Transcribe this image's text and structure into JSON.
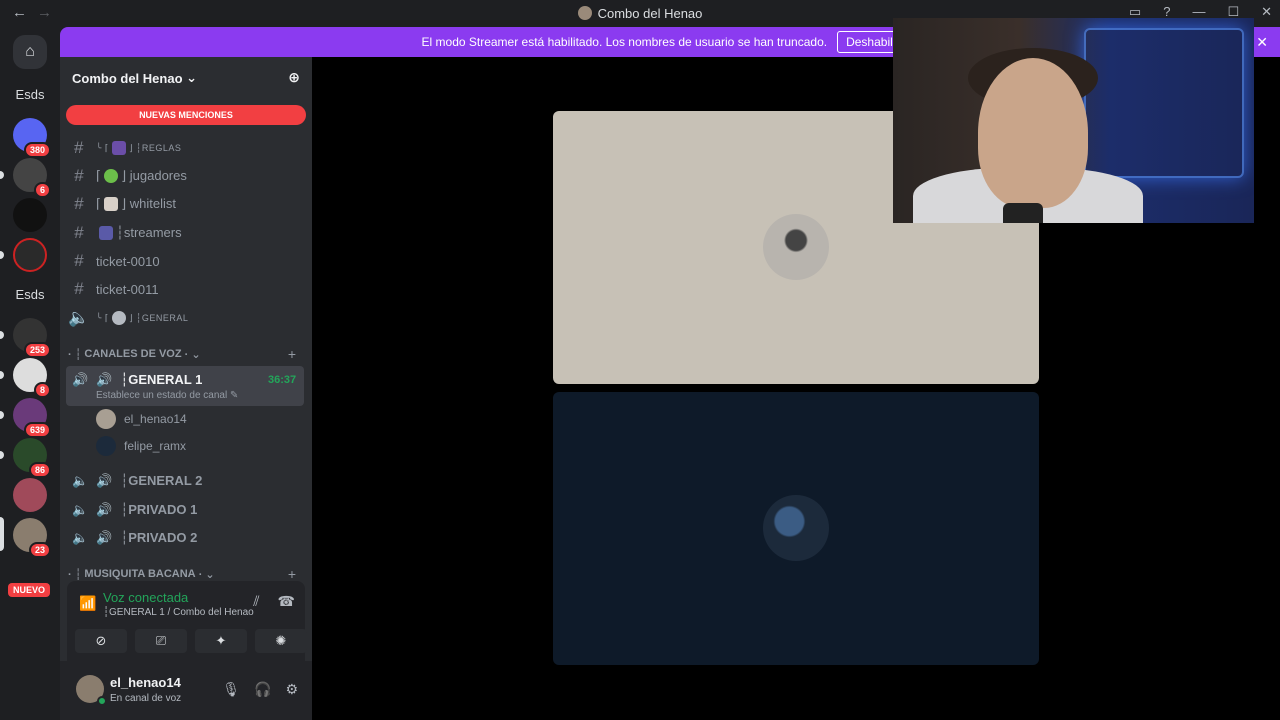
{
  "window": {
    "title": "Combo del Henao",
    "back": "←",
    "forward": "→",
    "controls": [
      "▭",
      "?",
      "—",
      "☐",
      "✕"
    ]
  },
  "banner": {
    "text": "El modo Streamer está habilitado. Los nombres de usuario se han truncado.",
    "button": "Deshabilitar",
    "close": "✕"
  },
  "servers": {
    "home": "⌂",
    "folder1": "Esds",
    "folder2": "Esds",
    "badges": [
      "380",
      "6",
      "253",
      "8",
      "639",
      "86",
      "23"
    ],
    "new_label": "NUEVO"
  },
  "guild": {
    "name": "Combo del Henao",
    "chevron": "⌄",
    "invite_icon": "⊕",
    "mentions_banner": "NUEVAS MENCIONES"
  },
  "text_channels": [
    {
      "prefix": "╰ ⌈",
      "name": "⌋ ┆REGLAS"
    },
    {
      "prefix": "⌈",
      "name": "⌋ jugadores"
    },
    {
      "prefix": "⌈",
      "name": "⌋ whitelist"
    },
    {
      "prefix": "",
      "name": "┆streamers"
    },
    {
      "prefix": "",
      "name": "ticket-0010"
    },
    {
      "prefix": "",
      "name": "ticket-0011"
    },
    {
      "prefix": "╰ ⌈",
      "name": "⌋ ┆GENERAL"
    }
  ],
  "voice_category": {
    "name": "CANALES DE VOZ",
    "decor": "· ┆",
    "suffix": "· ⌄",
    "plus": "+"
  },
  "active_voice": {
    "name": "┆GENERAL 1",
    "timer": "36:37",
    "status": "Establece un estado de canal ✎",
    "members": [
      "el_henao14",
      "felipe_ramx"
    ]
  },
  "other_voice": [
    "┆GENERAL 2",
    "┆PRIVADO 1",
    "┆PRIVADO 2"
  ],
  "music_category": {
    "name": "MUSIQUITA BACANA",
    "decor": "· ┆",
    "suffix": "· ⌄",
    "plus": "+"
  },
  "voice_panel": {
    "title": "Voz conectada",
    "subtitle": "┆GENERAL 1 / Combo del Henao",
    "buttons": [
      "⊘",
      "⎚",
      "✦",
      "✺"
    ]
  },
  "user": {
    "name": "el_henao14",
    "status": "En canal de voz"
  },
  "accent": {
    "banner": "#8b3bf0",
    "connected": "#23a55a",
    "mention": "#f23f42"
  }
}
